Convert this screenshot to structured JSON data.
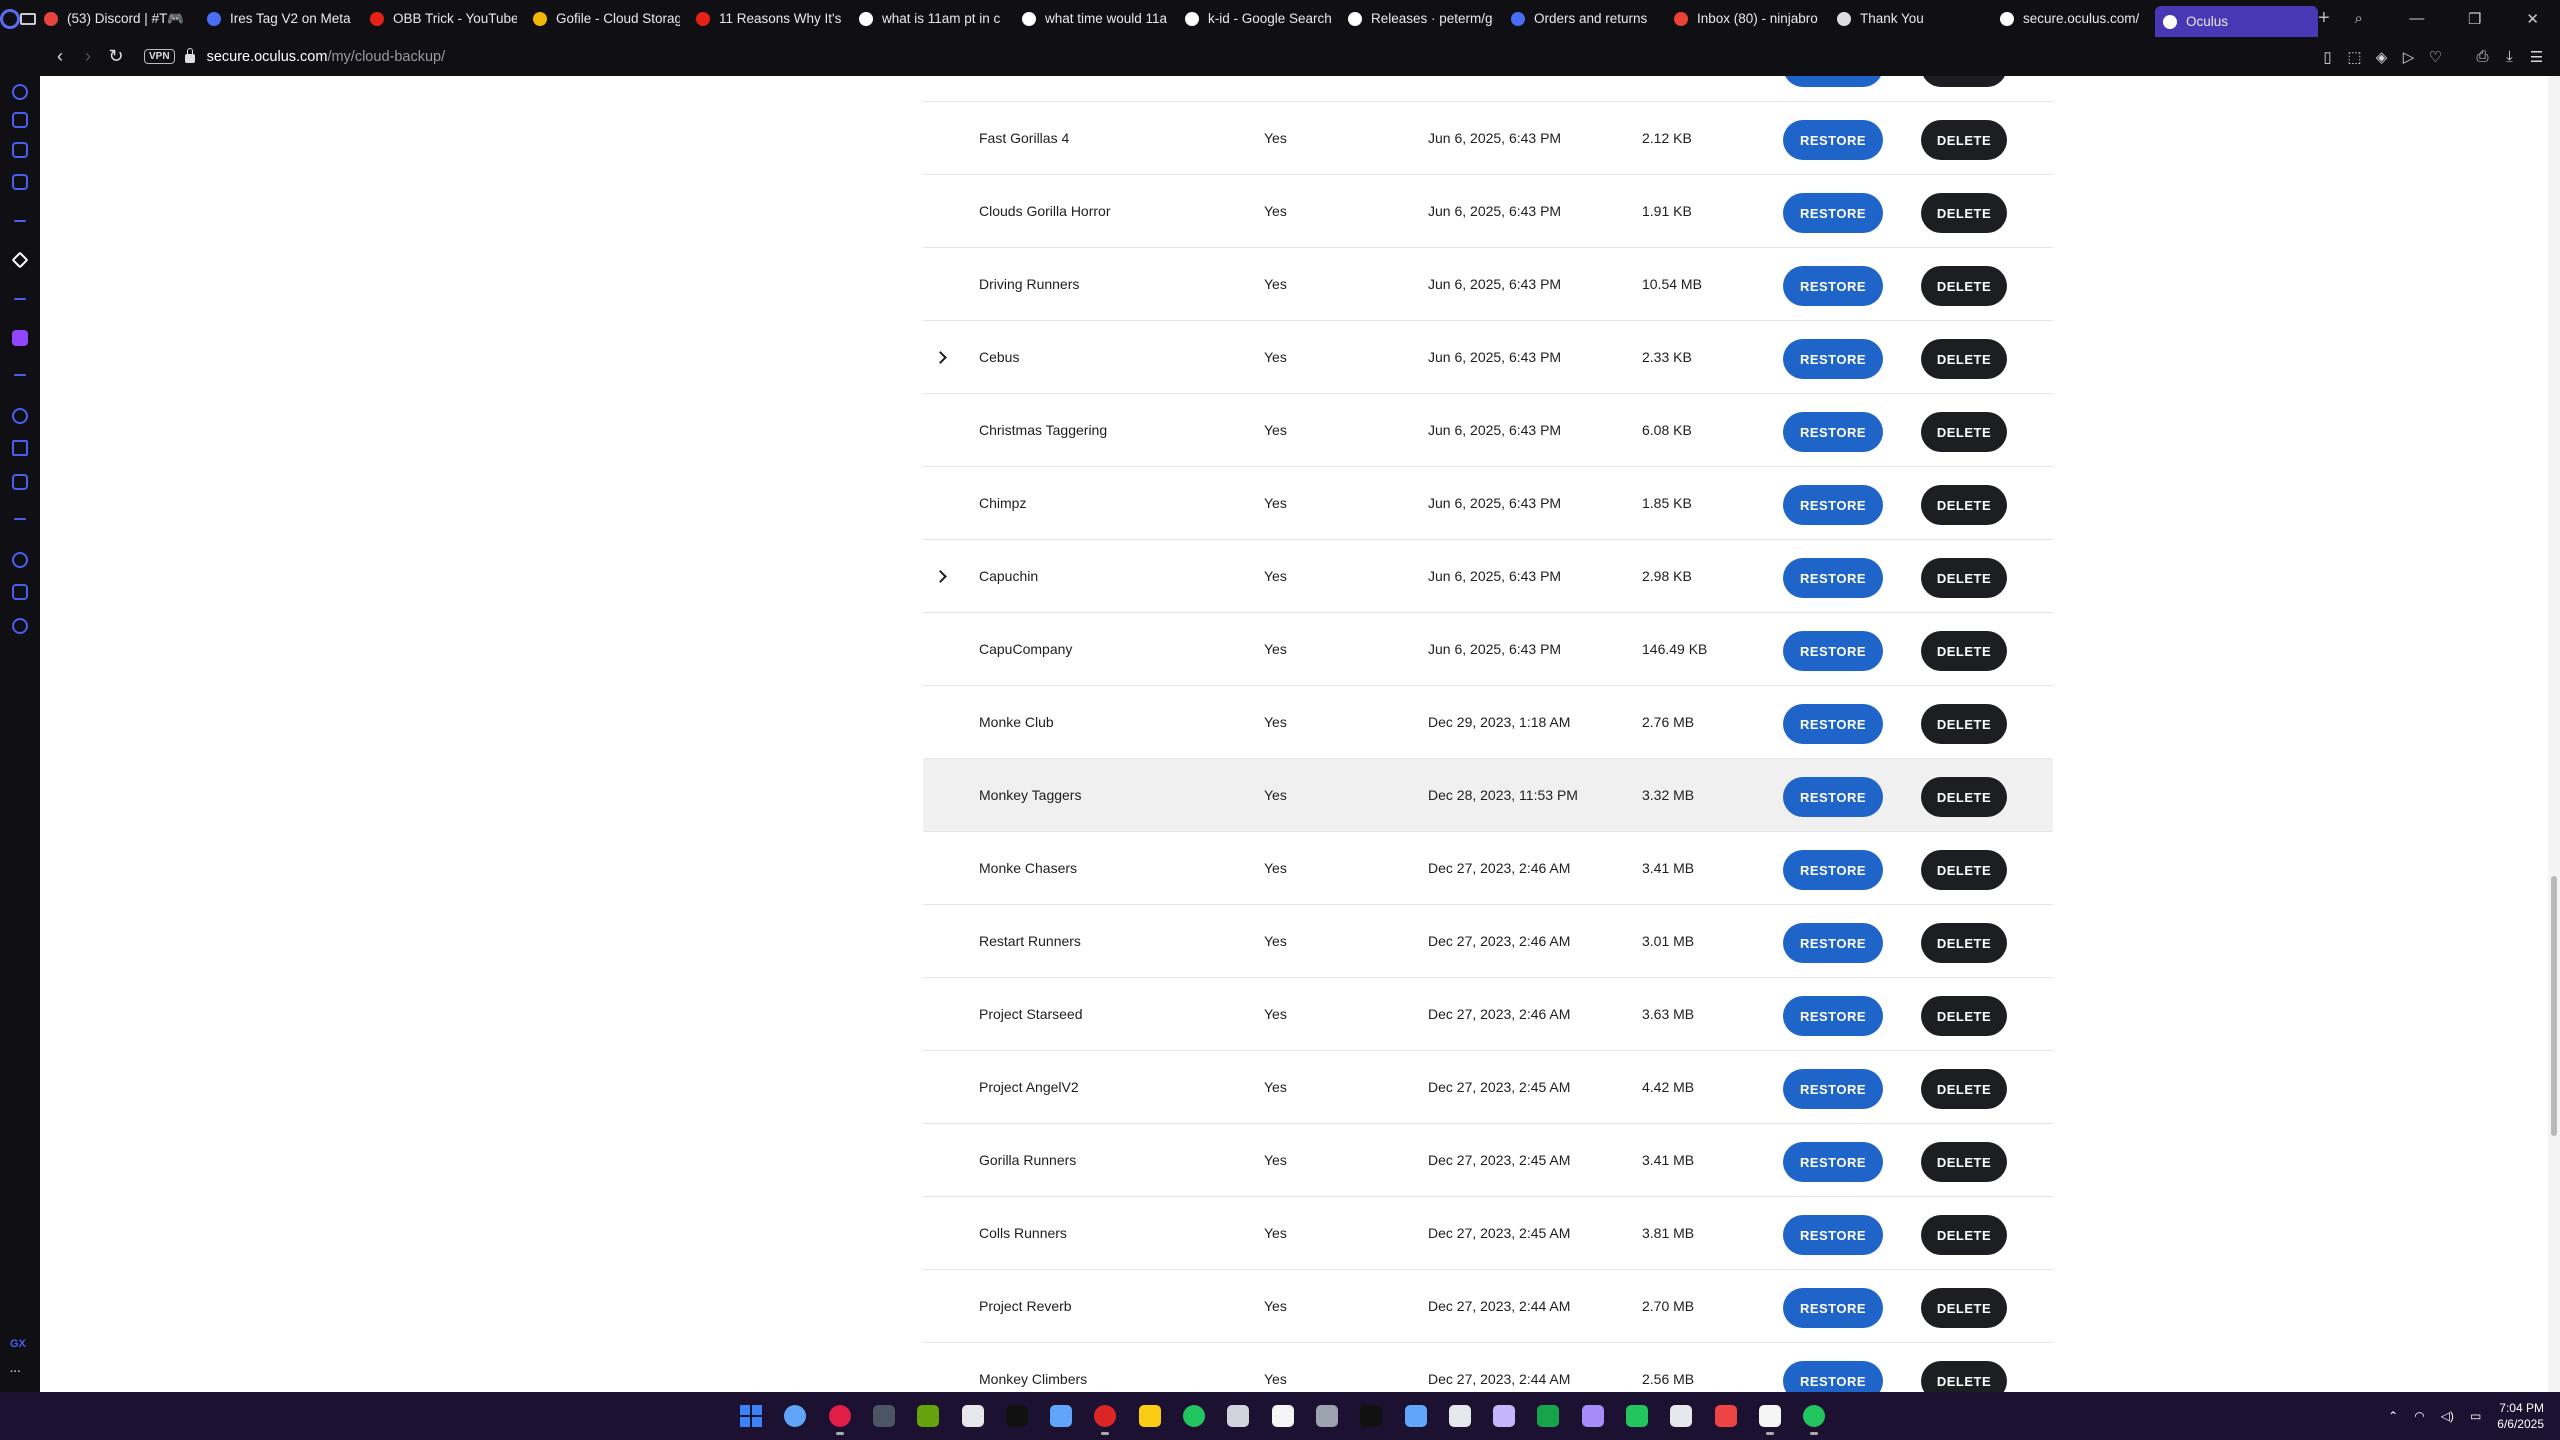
{
  "browser": {
    "tabs": [
      {
        "title": "(53) Discord | #T🎮",
        "icon_color": "#e5453c",
        "icon": "discord-icon"
      },
      {
        "title": "Ires Tag V2 on Meta",
        "icon_color": "#4a6cf7",
        "icon": "meta-icon"
      },
      {
        "title": "OBB Trick - YouTube",
        "icon_color": "#e62117",
        "icon": "youtube-icon"
      },
      {
        "title": "Gofile - Cloud Storag",
        "icon_color": "#f2b705",
        "icon": "gofile-icon"
      },
      {
        "title": "11 Reasons Why It's",
        "icon_color": "#e62117",
        "icon": "youtube-icon"
      },
      {
        "title": "what is 11am pt in c",
        "icon_color": "#ffffff",
        "icon": "google-icon"
      },
      {
        "title": "what time would 11a",
        "icon_color": "#ffffff",
        "icon": "google-icon"
      },
      {
        "title": "k-id - Google Search",
        "icon_color": "#ffffff",
        "icon": "google-icon"
      },
      {
        "title": "Releases · peterm/g",
        "icon_color": "#ffffff",
        "icon": "github-icon"
      },
      {
        "title": "Orders and returns",
        "icon_color": "#4a6cf7",
        "icon": "meta-icon"
      },
      {
        "title": "Inbox (80) - ninjabro",
        "icon_color": "#ea4335",
        "icon": "gmail-icon"
      },
      {
        "title": "Thank You",
        "icon_color": "#dddddd",
        "icon": "page-icon"
      },
      {
        "title": "secure.oculus.com/",
        "icon_color": "#ffffff",
        "icon": "globe-icon"
      },
      {
        "title": "Oculus",
        "icon_color": "#ffffff",
        "icon": "globe-icon",
        "active": true
      }
    ],
    "url_host": "secure.oculus.com",
    "url_path": "/my/cloud-backup/",
    "vpn_label": "VPN"
  },
  "table": {
    "restore_label": "RESTORE",
    "delete_label": "DELETE",
    "rows": [
      {
        "name": "",
        "cloud": "",
        "date": "",
        "size": "",
        "expandable": false
      },
      {
        "name": "Fast Gorillas 4",
        "cloud": "Yes",
        "date": "Jun 6, 2025, 6:43 PM",
        "size": "2.12 KB",
        "expandable": false
      },
      {
        "name": "Clouds Gorilla Horror",
        "cloud": "Yes",
        "date": "Jun 6, 2025, 6:43 PM",
        "size": "1.91 KB",
        "expandable": false
      },
      {
        "name": "Driving Runners",
        "cloud": "Yes",
        "date": "Jun 6, 2025, 6:43 PM",
        "size": "10.54 MB",
        "expandable": false
      },
      {
        "name": "Cebus",
        "cloud": "Yes",
        "date": "Jun 6, 2025, 6:43 PM",
        "size": "2.33 KB",
        "expandable": true
      },
      {
        "name": "Christmas Taggering",
        "cloud": "Yes",
        "date": "Jun 6, 2025, 6:43 PM",
        "size": "6.08 KB",
        "expandable": false
      },
      {
        "name": "Chimpz",
        "cloud": "Yes",
        "date": "Jun 6, 2025, 6:43 PM",
        "size": "1.85 KB",
        "expandable": false
      },
      {
        "name": "Capuchin",
        "cloud": "Yes",
        "date": "Jun 6, 2025, 6:43 PM",
        "size": "2.98 KB",
        "expandable": true
      },
      {
        "name": "CapuCompany",
        "cloud": "Yes",
        "date": "Jun 6, 2025, 6:43 PM",
        "size": "146.49 KB",
        "expandable": false
      },
      {
        "name": "Monke Club",
        "cloud": "Yes",
        "date": "Dec 29, 2023, 1:18 AM",
        "size": "2.76 MB",
        "expandable": false
      },
      {
        "name": "Monkey Taggers",
        "cloud": "Yes",
        "date": "Dec 28, 2023, 11:53 PM",
        "size": "3.32 MB",
        "expandable": false,
        "highlighted": true
      },
      {
        "name": "Monke Chasers",
        "cloud": "Yes",
        "date": "Dec 27, 2023, 2:46 AM",
        "size": "3.41 MB",
        "expandable": false
      },
      {
        "name": "Restart Runners",
        "cloud": "Yes",
        "date": "Dec 27, 2023, 2:46 AM",
        "size": "3.01 MB",
        "expandable": false
      },
      {
        "name": "Project Starseed",
        "cloud": "Yes",
        "date": "Dec 27, 2023, 2:46 AM",
        "size": "3.63 MB",
        "expandable": false
      },
      {
        "name": "Project AngelV2",
        "cloud": "Yes",
        "date": "Dec 27, 2023, 2:45 AM",
        "size": "4.42 MB",
        "expandable": false
      },
      {
        "name": "Gorilla Runners",
        "cloud": "Yes",
        "date": "Dec 27, 2023, 2:45 AM",
        "size": "3.41 MB",
        "expandable": false
      },
      {
        "name": "Colls Runners",
        "cloud": "Yes",
        "date": "Dec 27, 2023, 2:45 AM",
        "size": "3.81 MB",
        "expandable": false
      },
      {
        "name": "Project Reverb",
        "cloud": "Yes",
        "date": "Dec 27, 2023, 2:44 AM",
        "size": "2.70 MB",
        "expandable": false
      },
      {
        "name": "Monkey Climbers",
        "cloud": "Yes",
        "date": "Dec 27, 2023, 2:44 AM",
        "size": "2.56 MB",
        "expandable": false
      }
    ]
  },
  "taskbar": {
    "time": "7:04 PM",
    "date": "6/6/2025",
    "apps": [
      {
        "icon": "windows-start-icon",
        "color": "#3b82f6"
      },
      {
        "icon": "search-icon",
        "color": "#60a5fa"
      },
      {
        "icon": "opera-icon",
        "color": "#e11d48"
      },
      {
        "icon": "app-icon",
        "color": "#4b5563"
      },
      {
        "icon": "game-icon",
        "color": "#65a30d"
      },
      {
        "icon": "terminal-icon",
        "color": "#e5e7eb"
      },
      {
        "icon": "tiktok-icon",
        "color": "#111111"
      },
      {
        "icon": "store-icon",
        "color": "#60a5fa"
      },
      {
        "icon": "opera-gx-icon",
        "color": "#dc2626"
      },
      {
        "icon": "file-explorer-icon",
        "color": "#facc15"
      },
      {
        "icon": "spotify-icon",
        "color": "#22c55e"
      },
      {
        "icon": "notepad-icon",
        "color": "#d1d5db"
      },
      {
        "icon": "app-icon",
        "color": "#f5f5f5"
      },
      {
        "icon": "app-icon",
        "color": "#9ca3af"
      },
      {
        "icon": "app-icon",
        "color": "#111111"
      },
      {
        "icon": "app-icon",
        "color": "#60a5fa"
      },
      {
        "icon": "github-icon",
        "color": "#e5e7eb"
      },
      {
        "icon": "app-icon",
        "color": "#c4b5fd"
      },
      {
        "icon": "minecraft-icon",
        "color": "#16a34a"
      },
      {
        "icon": "folder-icon",
        "color": "#a78bfa"
      },
      {
        "icon": "app-icon",
        "color": "#22c55e"
      },
      {
        "icon": "app-icon",
        "color": "#e5e7eb"
      },
      {
        "icon": "youtube-icon",
        "color": "#ef4444"
      },
      {
        "icon": "app-icon",
        "color": "#f5f5f5"
      },
      {
        "icon": "xbox-icon",
        "color": "#22c55e"
      }
    ]
  }
}
